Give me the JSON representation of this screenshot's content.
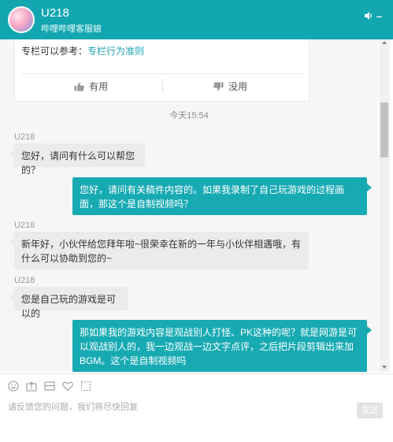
{
  "header": {
    "title": "U218",
    "subtitle": "哔哩哔哩客服娘",
    "min_symbol": "–"
  },
  "faq_card": {
    "text_prefix": "专栏可以参考：",
    "link_text": "专栏行为准则",
    "useful_label": "有用",
    "useless_label": "没用"
  },
  "timestamp": "今天15:54",
  "messages": [
    {
      "sender": "U218",
      "direction": "in",
      "text": "您好，请问有什么可以帮您的？"
    },
    {
      "direction": "out",
      "text": "您好，请问有关稿件内容的。如果我录制了自己玩游戏的过程画面，那这个是自制视频吗？"
    },
    {
      "sender": "U218",
      "direction": "in",
      "text": "新年好，小伙伴给您拜年啦~很荣幸在新的一年与小伙伴相遇哦，有什么可以协助到您的~"
    },
    {
      "sender": "U218",
      "direction": "in",
      "text": "您是自己玩的游戏是可以的"
    },
    {
      "direction": "out",
      "text": "那如果我的游戏内容是观战别人打怪、PK这种的呢？就是网游是可以观战别人的，我一边观战一边文字点评，之后把片段剪辑出来加BGM。这个是自制视频吗"
    }
  ],
  "input": {
    "placeholder": "请反馈您的问题，我们将尽快回复",
    "send_label": "发送"
  },
  "colors": {
    "accent": "#12a6b0",
    "outgoing_bubble": "#18aab3",
    "incoming_bubble": "#ebebeb"
  },
  "icons": [
    "sound-icon",
    "emoji-icon",
    "upload-image-icon",
    "screenshot-icon",
    "heart-icon",
    "crop-icon",
    "thumbs-up-icon",
    "thumbs-down-icon"
  ]
}
